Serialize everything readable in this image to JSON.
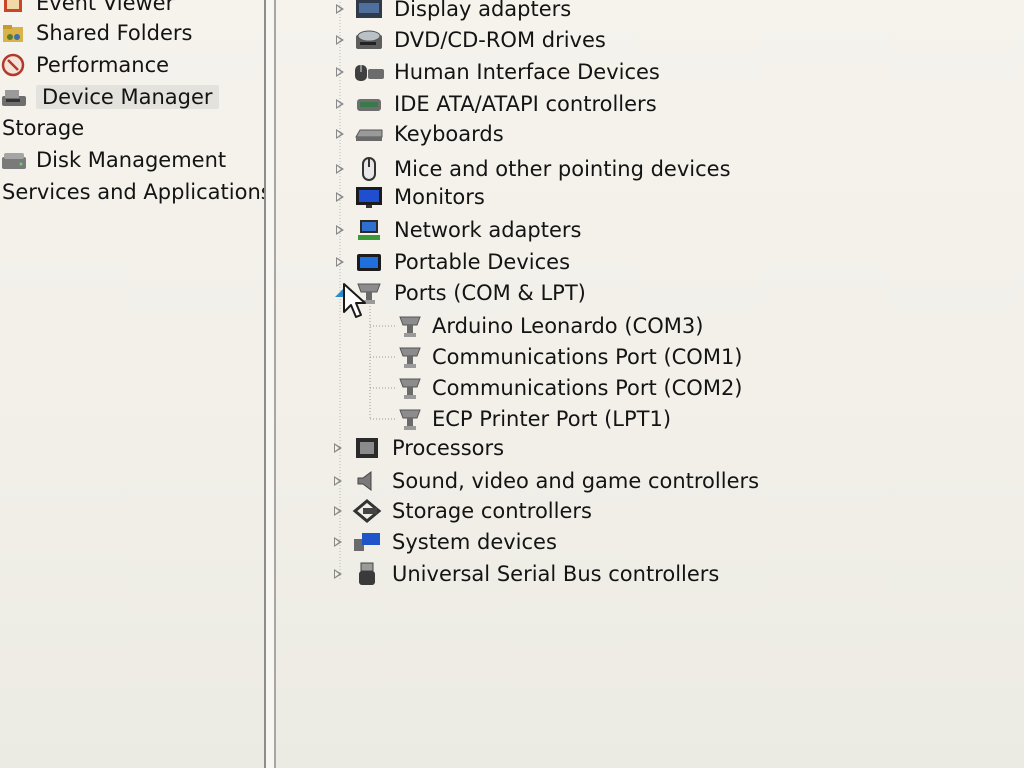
{
  "sidebar": {
    "items": [
      {
        "label": "Event Viewer",
        "icon": "event-viewer-icon"
      },
      {
        "label": "Shared Folders",
        "icon": "shared-folders-icon"
      },
      {
        "label": "Performance",
        "icon": "performance-icon"
      },
      {
        "label": "Device Manager",
        "icon": "device-manager-icon",
        "selected": true
      },
      {
        "label": "Storage",
        "icon": ""
      },
      {
        "label": "Disk Management",
        "icon": "disk-management-icon"
      },
      {
        "label": "Services and Applications",
        "icon": ""
      }
    ]
  },
  "device_tree": {
    "categories": [
      {
        "label": "Display adapters",
        "icon": "display-adapter-icon",
        "state": "collapsed"
      },
      {
        "label": "DVD/CD-ROM drives",
        "icon": "dvd-drive-icon",
        "state": "collapsed"
      },
      {
        "label": "Human Interface Devices",
        "icon": "hid-icon",
        "state": "collapsed"
      },
      {
        "label": "IDE ATA/ATAPI controllers",
        "icon": "ide-controller-icon",
        "state": "collapsed"
      },
      {
        "label": "Keyboards",
        "icon": "keyboard-icon",
        "state": "collapsed"
      },
      {
        "label": "Mice and other pointing devices",
        "icon": "mouse-icon",
        "state": "collapsed"
      },
      {
        "label": "Monitors",
        "icon": "monitor-icon",
        "state": "collapsed"
      },
      {
        "label": "Network adapters",
        "icon": "network-adapter-icon",
        "state": "collapsed"
      },
      {
        "label": "Portable Devices",
        "icon": "portable-device-icon",
        "state": "collapsed"
      },
      {
        "label": "Ports (COM & LPT)",
        "icon": "port-icon",
        "state": "expanded"
      },
      {
        "label": "Processors",
        "icon": "processor-icon",
        "state": "collapsed"
      },
      {
        "label": "Sound, video and game controllers",
        "icon": "sound-icon",
        "state": "collapsed"
      },
      {
        "label": "Storage controllers",
        "icon": "storage-controller-icon",
        "state": "collapsed"
      },
      {
        "label": "System devices",
        "icon": "system-device-icon",
        "state": "collapsed"
      },
      {
        "label": "Universal Serial Bus controllers",
        "icon": "usb-icon",
        "state": "collapsed"
      }
    ],
    "ports_children": [
      {
        "label": "Arduino Leonardo (COM3)",
        "icon": "port-icon"
      },
      {
        "label": "Communications Port (COM1)",
        "icon": "port-icon"
      },
      {
        "label": "Communications Port (COM2)",
        "icon": "port-icon"
      },
      {
        "label": "ECP Printer Port (LPT1)",
        "icon": "port-icon"
      }
    ]
  },
  "colors": {
    "background": "#f3f1ea",
    "text": "#141414",
    "expander_collapsed": "#8a8a8a",
    "expander_expanded": "#2a8ccc",
    "selection": "#e4e2dc"
  }
}
